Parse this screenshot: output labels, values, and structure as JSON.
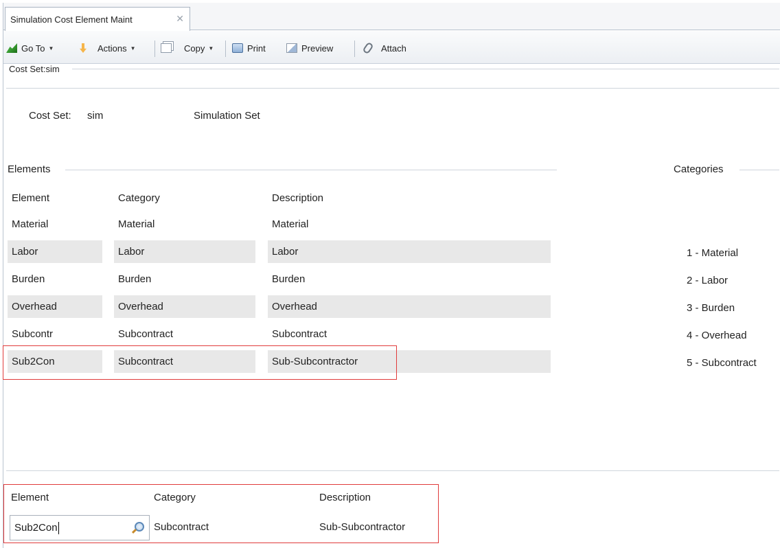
{
  "tab": {
    "title": "Simulation Cost Element Maint",
    "close": "✕"
  },
  "toolbar": {
    "goto": "Go To",
    "actions": "Actions",
    "copy": "Copy",
    "print": "Print",
    "preview": "Preview",
    "attach": "Attach",
    "caret": "▼"
  },
  "costset_group": {
    "label": "Cost Set:sim"
  },
  "costset": {
    "label": "Cost Set:",
    "id": "sim",
    "description": "Simulation Set"
  },
  "elements_group": {
    "label": "Elements",
    "headers": {
      "element": "Element",
      "category": "Category",
      "description": "Description"
    },
    "rows": [
      {
        "element": "Material",
        "category": "Material",
        "description": "Material"
      },
      {
        "element": "Labor",
        "category": "Labor",
        "description": "Labor"
      },
      {
        "element": "Burden",
        "category": "Burden",
        "description": "Burden"
      },
      {
        "element": "Overhead",
        "category": "Overhead",
        "description": "Overhead"
      },
      {
        "element": "Subcontr",
        "category": "Subcontract",
        "description": "Subcontract"
      },
      {
        "element": "Sub2Con",
        "category": "Subcontract",
        "description": "Sub-Subcontractor"
      }
    ]
  },
  "categories_group": {
    "label": "Categories",
    "items": [
      "1 - Material",
      "2 - Labor",
      "3 - Burden",
      "4 - Overhead",
      "5 - Subcontract"
    ]
  },
  "detail": {
    "element_label": "Element",
    "category_label": "Category",
    "description_label": "Description",
    "element_value": "Sub2Con",
    "category_value": "Subcontract",
    "description_value": "Sub-Subcontractor"
  },
  "colors": {
    "highlight": "#e03a3a",
    "row_shade": "#e8e8e8"
  }
}
